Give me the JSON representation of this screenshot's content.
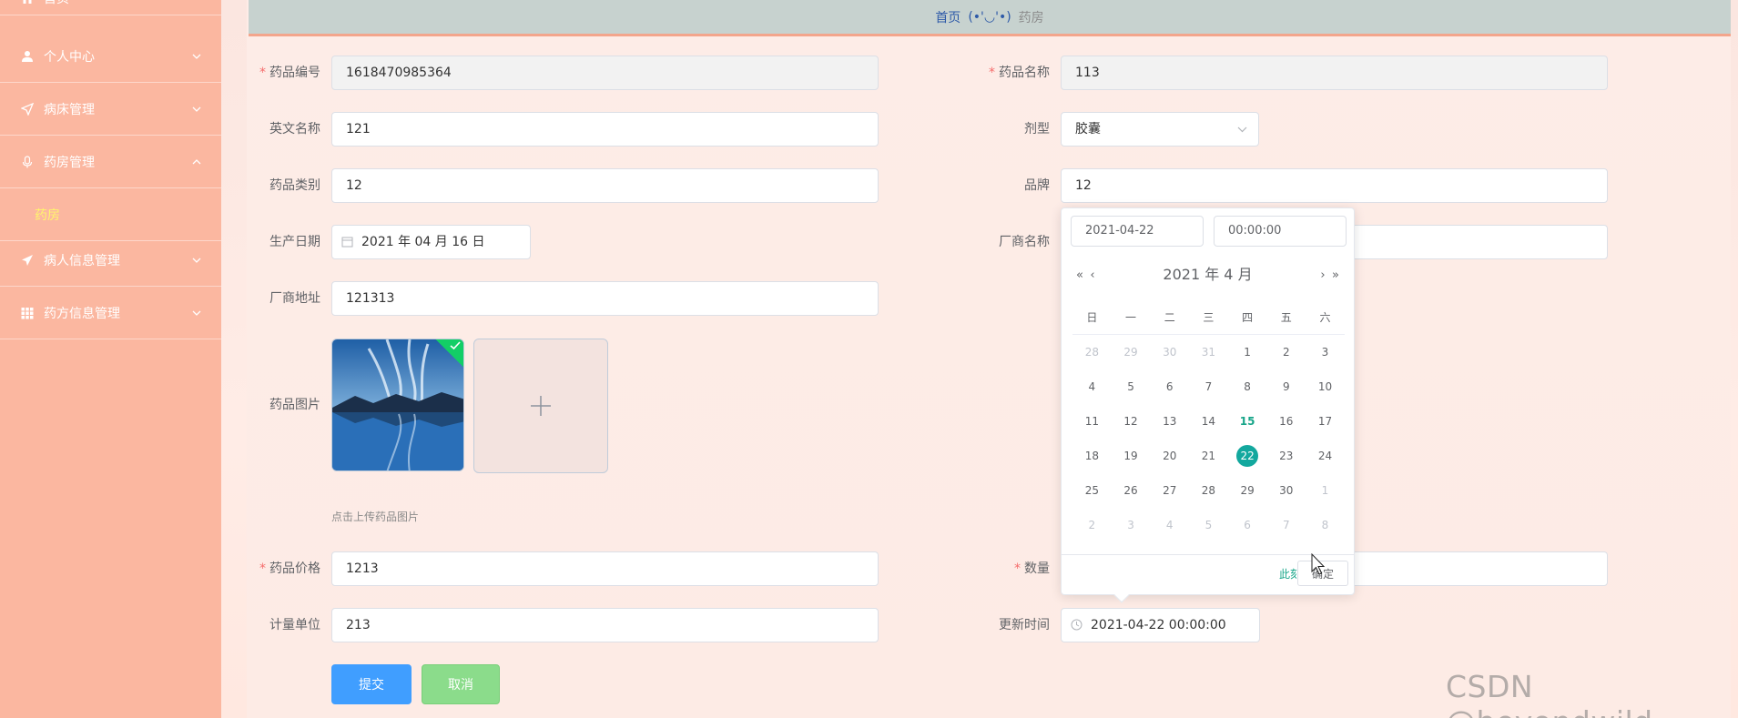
{
  "sidebar": {
    "items": [
      {
        "label": "首页",
        "icon": "home-icon"
      },
      {
        "label": "个人中心",
        "icon": "user-icon"
      },
      {
        "label": "病床管理",
        "icon": "send-icon"
      },
      {
        "label": "药房管理",
        "icon": "microphone-icon"
      },
      {
        "label": "病人信息管理",
        "icon": "plane-icon"
      },
      {
        "label": "药方信息管理",
        "icon": "grid-icon"
      }
    ],
    "submenu": {
      "label": "药房"
    }
  },
  "breadcrumb": {
    "home": "首页",
    "separator": "(•'◡'•)",
    "current": "药房"
  },
  "form": {
    "drug_code": {
      "label": "药品编号",
      "value": "1618470985364"
    },
    "drug_name": {
      "label": "药品名称",
      "value": "113"
    },
    "english_name": {
      "label": "英文名称",
      "value": "121"
    },
    "dosage_form": {
      "label": "剂型",
      "value": "胶囊"
    },
    "category": {
      "label": "药品类别",
      "value": "12"
    },
    "brand": {
      "label": "品牌",
      "value": "12"
    },
    "production_date": {
      "label": "生产日期",
      "value": "2021 年 04 月 16 日"
    },
    "manufacturer_name": {
      "label": "厂商名称",
      "value": ""
    },
    "manufacturer_address": {
      "label": "厂商地址",
      "value": "121313"
    },
    "image": {
      "label": "药品图片",
      "tip": "点击上传药品图片"
    },
    "price": {
      "label": "药品价格",
      "value": "1213"
    },
    "quantity": {
      "label": "数量",
      "value": ""
    },
    "unit": {
      "label": "计量单位",
      "value": "213"
    },
    "update_time": {
      "label": "更新时间",
      "value": "2021-04-22 00:00:00"
    },
    "submit": "提交",
    "cancel": "取消"
  },
  "datepicker": {
    "date_input": "2021-04-22",
    "time_input": "00:00:00",
    "header": "2021 年  4 月",
    "weekdays": [
      "日",
      "一",
      "二",
      "三",
      "四",
      "五",
      "六"
    ],
    "weeks": [
      [
        "28",
        "29",
        "30",
        "31",
        "1",
        "2",
        "3"
      ],
      [
        "4",
        "5",
        "6",
        "7",
        "8",
        "9",
        "10"
      ],
      [
        "11",
        "12",
        "13",
        "14",
        "15",
        "16",
        "17"
      ],
      [
        "18",
        "19",
        "20",
        "21",
        "22",
        "23",
        "24"
      ],
      [
        "25",
        "26",
        "27",
        "28",
        "29",
        "30",
        "1"
      ],
      [
        "2",
        "3",
        "4",
        "5",
        "6",
        "7",
        "8"
      ]
    ],
    "today": "15",
    "selected": "22",
    "now_label": "此刻",
    "ok_label": "确定"
  },
  "watermark": "CSDN @beyondwild",
  "colors": {
    "sidebar": "#fbb7a0",
    "primary": "#409eff",
    "cancel": "#8bdc8b",
    "accent": "#13a89e"
  }
}
